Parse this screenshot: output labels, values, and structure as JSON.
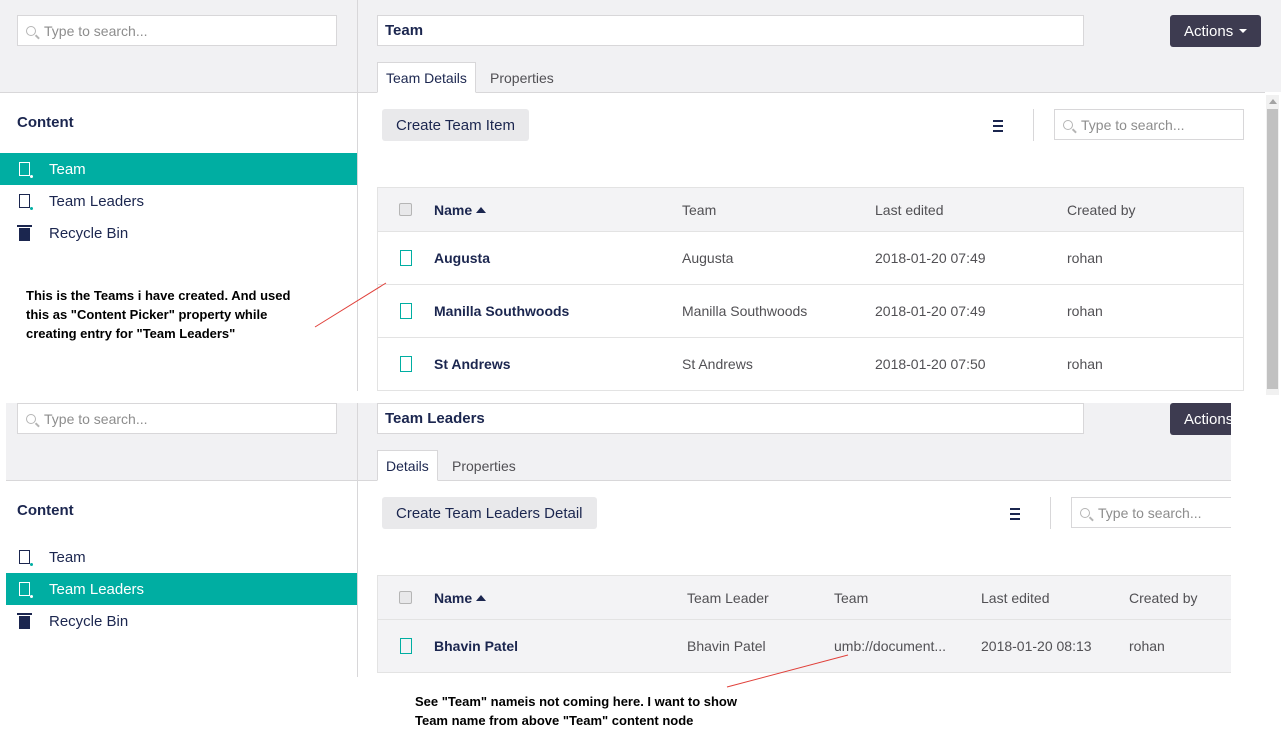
{
  "panel1": {
    "tree_search_placeholder": "Type to search...",
    "node_name": "Team",
    "actions_label": "Actions",
    "tabs": [
      "Team Details",
      "Properties"
    ],
    "content_title": "Content",
    "tree": [
      {
        "label": "Team",
        "icon": "document-icon",
        "selected": true
      },
      {
        "label": "Team Leaders",
        "icon": "document-icon",
        "selected": false
      },
      {
        "label": "Recycle Bin",
        "icon": "trash-icon",
        "selected": false
      }
    ],
    "create_label": "Create Team Item",
    "list_search_placeholder": "Type to search...",
    "columns": [
      "Name",
      "Team",
      "Last edited",
      "Created by"
    ],
    "rows": [
      {
        "name": "Augusta",
        "team": "Augusta",
        "last_edited": "2018-01-20 07:49",
        "created_by": "rohan"
      },
      {
        "name": "Manilla Southwoods",
        "team": "Manilla Southwoods",
        "last_edited": "2018-01-20 07:49",
        "created_by": "rohan"
      },
      {
        "name": "St Andrews",
        "team": "St Andrews",
        "last_edited": "2018-01-20 07:50",
        "created_by": "rohan"
      }
    ]
  },
  "panel2": {
    "tree_search_placeholder": "Type to search...",
    "node_name": "Team Leaders",
    "actions_label": "Actions",
    "tabs": [
      "Details",
      "Properties"
    ],
    "content_title": "Content",
    "tree": [
      {
        "label": "Team",
        "icon": "document-icon",
        "selected": false
      },
      {
        "label": "Team Leaders",
        "icon": "document-icon",
        "selected": true
      },
      {
        "label": "Recycle Bin",
        "icon": "trash-icon",
        "selected": false
      }
    ],
    "create_label": "Create Team Leaders Detail",
    "list_search_placeholder": "Type to search...",
    "columns": [
      "Name",
      "Team Leader",
      "Team",
      "Last edited",
      "Created by"
    ],
    "rows": [
      {
        "name": "Bhavin Patel",
        "team_leader": "Bhavin Patel",
        "team": "umb://document...",
        "last_edited": "2018-01-20 08:13",
        "created_by": "rohan"
      }
    ]
  },
  "annotations": {
    "note1": [
      "This is the Teams i have created. And used",
      "this as \"Content Picker\" property while",
      "creating entry for \"Team Leaders\""
    ],
    "note2": [
      "See \"Team\" nameis not coming here. I want to show",
      "Team name from above \"Team\" content node"
    ],
    "line_color": "#e0403a"
  },
  "colors": {
    "accent": "#00aea2",
    "actions_bg": "#3d3b50",
    "header_bg": "#f1f1f3",
    "text": "#1b264f"
  }
}
